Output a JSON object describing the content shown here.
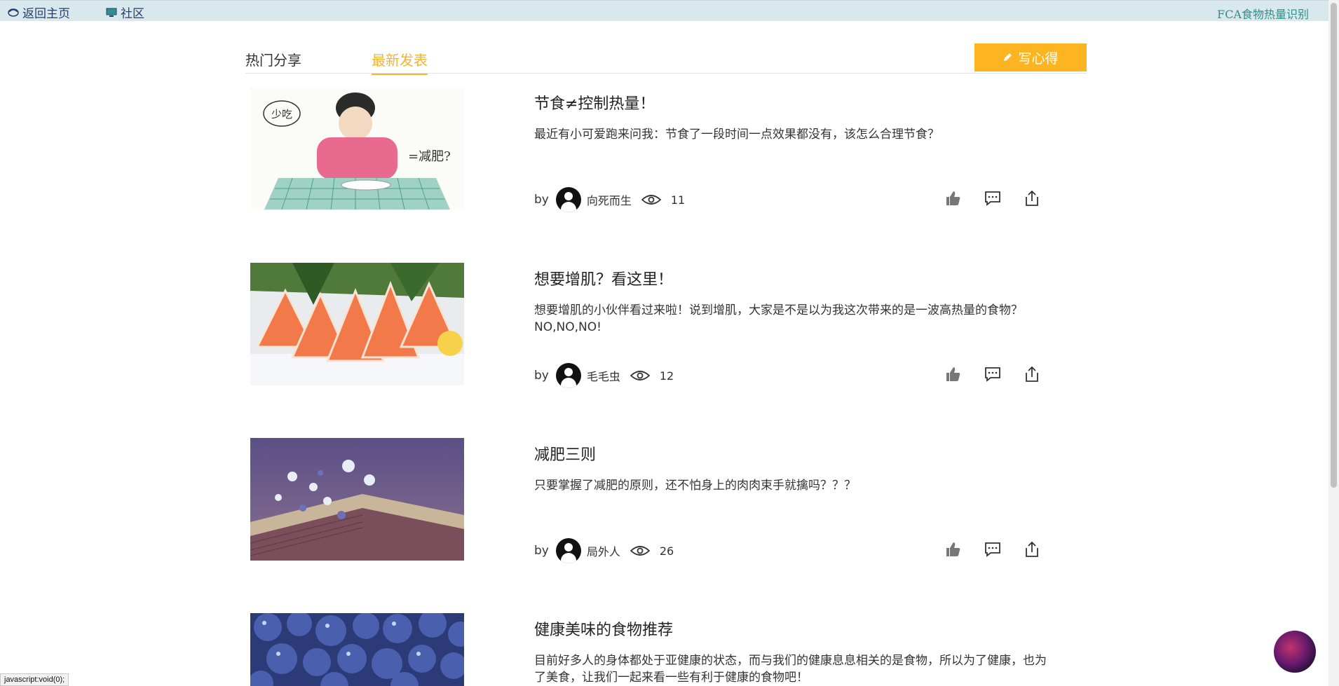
{
  "topbar": {
    "home_label": "返回主页",
    "community_label": "社区",
    "brand": "FCA食物热量识别"
  },
  "tabs": [
    {
      "label": "热门分享",
      "active": false
    },
    {
      "label": "最新发表",
      "active": true
    }
  ],
  "write_button": {
    "label": "写心得",
    "icon": "pencil-icon"
  },
  "posts": [
    {
      "title": "节食≠控制热量！",
      "summary": "最近有小可爱跑来问我：节食了一段时间一点效果都没有，该怎么合理节食？",
      "by": "by",
      "author": "向死而生",
      "views": "11",
      "image": "illustration-girl-eating"
    },
    {
      "title": "想要增肌？看这里！",
      "summary": "想要增肌的小伙伴看过来啦！说到增肌，大家是不是以为我这次带来的是一波高热量的食物？NO,NO,NO!",
      "by": "by",
      "author": "毛毛虫",
      "views": "12",
      "image": "salmon-sashimi"
    },
    {
      "title": "减肥三则",
      "summary": "只要掌握了减肥的原则，还不怕身上的肉肉束手就擒吗？？？",
      "by": "by",
      "author": "局外人",
      "views": "26",
      "image": "flowers-on-book"
    },
    {
      "title": "健康美味的食物推荐",
      "summary": "目前好多人的身体都处于亚健康的状态，而与我们的健康息息相关的是食物，所以为了健康，也为了美食，让我们一起来看一些有利于健康的食物吧！",
      "by": "by",
      "author": "",
      "views": "",
      "image": "blueberries"
    }
  ],
  "status_bar": "javascript:void(0);",
  "colors": {
    "accent": "#fcb520",
    "active_tab": "#f5b32e",
    "topbar_bg": "#d9e8ec",
    "brand": "#2f8f8a"
  }
}
